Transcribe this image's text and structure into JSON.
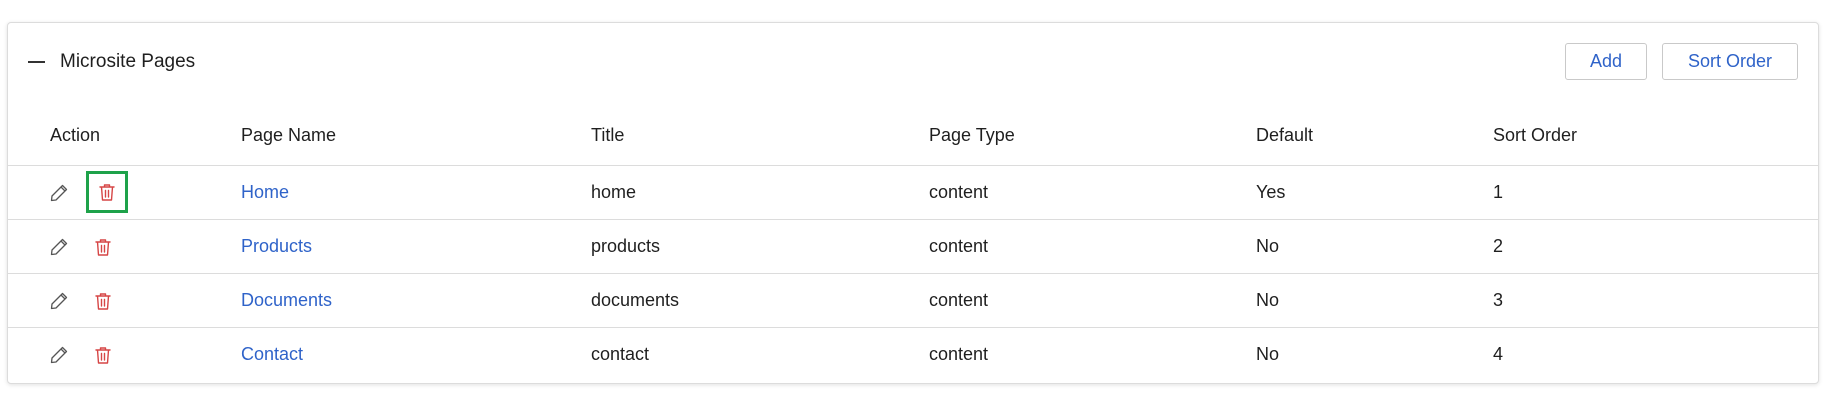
{
  "panel": {
    "title": "Microsite Pages",
    "add_label": "Add",
    "sort_order_label": "Sort Order"
  },
  "columns": [
    "Action",
    "Page Name",
    "Title",
    "Page Type",
    "Default",
    "Sort Order"
  ],
  "rows": [
    {
      "page_name": "Home",
      "title": "home",
      "page_type": "content",
      "default": "Yes",
      "sort_order": "1"
    },
    {
      "page_name": "Products",
      "title": "products",
      "page_type": "content",
      "default": "No",
      "sort_order": "2"
    },
    {
      "page_name": "Documents",
      "title": "documents",
      "page_type": "content",
      "default": "No",
      "sort_order": "3"
    },
    {
      "page_name": "Contact",
      "title": "contact",
      "page_type": "content",
      "default": "No",
      "sort_order": "4"
    }
  ],
  "icons": {
    "edit": "pencil-icon",
    "delete": "trash-icon",
    "collapse": "minus-icon"
  },
  "colors": {
    "link": "#2f63c9",
    "delete_icon": "#d64545",
    "edit_icon": "#555555",
    "focus_outline": "#1ea24a"
  }
}
